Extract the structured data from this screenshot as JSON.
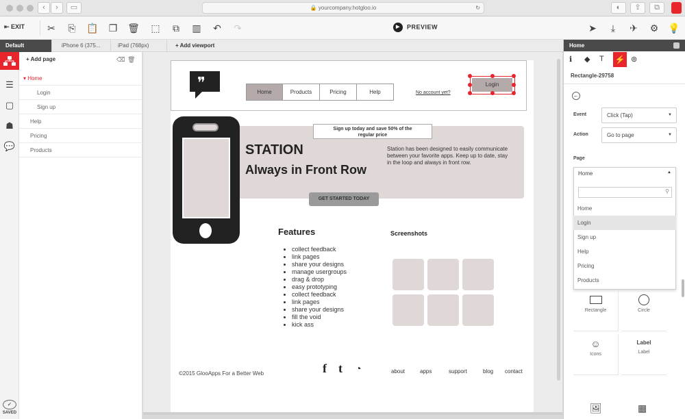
{
  "browser": {
    "url": "yourcompany.hotgloo.io",
    "back": "‹",
    "forward": "›"
  },
  "toolbar": {
    "exit_label": "EXIT",
    "preview_label": "PREVIEW"
  },
  "viewports": {
    "tabs": [
      "Default",
      "iPhone 6 (375...",
      "iPad (768px)"
    ],
    "add_label": "Add viewport"
  },
  "pages": {
    "add_label": "Add page",
    "items": [
      {
        "label": "Home"
      },
      {
        "label": "Login"
      },
      {
        "label": "Sign up"
      },
      {
        "label": "Help"
      },
      {
        "label": "Pricing"
      },
      {
        "label": "Products"
      }
    ]
  },
  "status": {
    "saved": "SAVED"
  },
  "mockup": {
    "nav": [
      "Home",
      "Products",
      "Pricing",
      "Help"
    ],
    "no_account": "No account yet?",
    "login": "Login",
    "signup_banner": "Sign up today and save 50% of the regular price",
    "hero_title": "STATION",
    "hero_subtitle": "Always in Front Row",
    "hero_text": "Station has been designed to easily communicate between your favorite apps. Keep up to date, stay in the loop and always in front row.",
    "cta": "GET STARTED TODAY",
    "features_title": "Features",
    "features": [
      "collect feedback",
      "link pages",
      "share your designs",
      "manage usergroups",
      "drag & drop",
      "easy prototyping",
      "collect feedback",
      "link pages",
      "share your designs",
      "fill the void",
      "kick ass"
    ],
    "screenshots_title": "Screenshots",
    "copyright": "©2015 GlooApps For a Better Web",
    "footer_links": [
      "about",
      "apps",
      "support",
      "blog",
      "contact"
    ]
  },
  "inspector": {
    "panel_title": "Home",
    "element_name": "Rectangle-29758",
    "event_label": "Event",
    "event_value": "Click (Tap)",
    "action_label": "Action",
    "action_value": "Go to page",
    "page_label": "Page",
    "page_value": "Home",
    "page_options": [
      "Home",
      "Login",
      "Sign up",
      "Help",
      "Pricing",
      "Products"
    ],
    "components": [
      "Rectangle",
      "Circle",
      "Icons",
      "Label"
    ],
    "label_preview": "Label"
  },
  "colors": {
    "accent": "#e8242c",
    "hero_bg": "#e0d8d7",
    "dark": "#4a4a4a"
  }
}
